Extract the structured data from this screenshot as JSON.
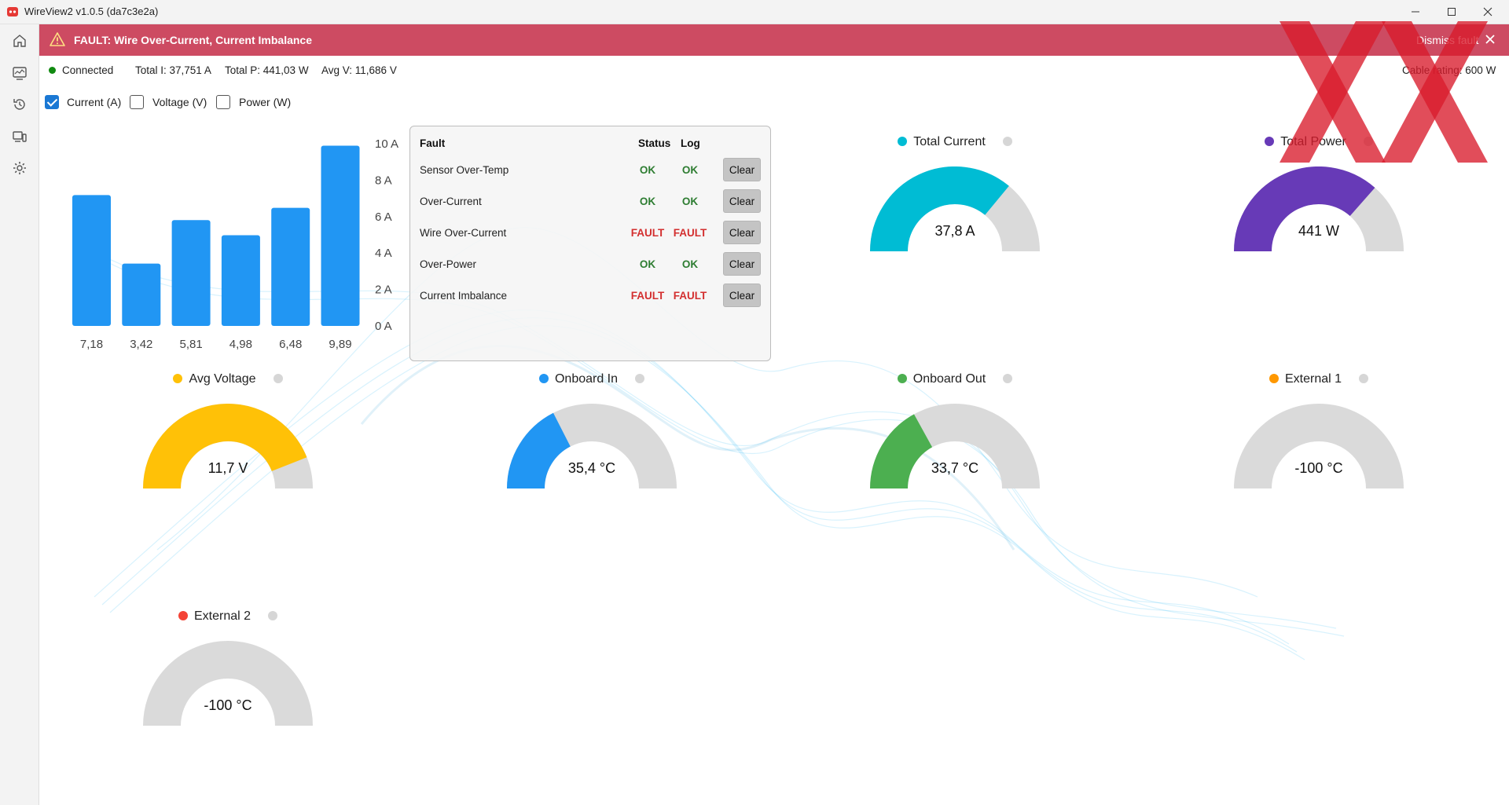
{
  "window": {
    "title": "WireView2 v1.0.5 (da7c3e2a)"
  },
  "fault_banner": {
    "message": "FAULT: Wire Over-Current, Current Imbalance",
    "dismiss_label": "Dismiss fault"
  },
  "status": {
    "connection": "Connected",
    "total_i": "Total I: 37,751 A",
    "total_p": "Total P: 441,03 W",
    "avg_v": "Avg V: 11,686 V",
    "cable_rating": "Cable rating: 600 W"
  },
  "toggles": [
    {
      "label": "Current (A)",
      "checked": true
    },
    {
      "label": "Voltage (V)",
      "checked": false
    },
    {
      "label": "Power (W)",
      "checked": false
    }
  ],
  "chart_data": {
    "type": "bar",
    "categories": [
      "7,18",
      "3,42",
      "5,81",
      "4,98",
      "6,48",
      "9,89"
    ],
    "values": [
      7.18,
      3.42,
      5.81,
      4.98,
      6.48,
      9.89
    ],
    "ylim": [
      0,
      10
    ],
    "y_ticks": [
      "0 A",
      "2 A",
      "4 A",
      "6 A",
      "8 A",
      "10 A"
    ],
    "bar_color": "#2196f3",
    "grid": false
  },
  "fault_table": {
    "headers": {
      "fault": "Fault",
      "status": "Status",
      "log": "Log"
    },
    "clear_label": "Clear",
    "rows": [
      {
        "name": "Sensor Over-Temp",
        "status": "OK",
        "log": "OK"
      },
      {
        "name": "Over-Current",
        "status": "OK",
        "log": "OK"
      },
      {
        "name": "Wire Over-Current",
        "status": "FAULT",
        "log": "FAULT"
      },
      {
        "name": "Over-Power",
        "status": "OK",
        "log": "OK"
      },
      {
        "name": "Current Imbalance",
        "status": "FAULT",
        "log": "FAULT"
      }
    ]
  },
  "gauges": [
    {
      "id": "total-current",
      "title": "Total Current",
      "value": "37,8 A",
      "fraction": 0.72,
      "color": "#00bcd4"
    },
    {
      "id": "total-power",
      "title": "Total Power",
      "value": "441 W",
      "fraction": 0.73,
      "color": "#673ab7"
    },
    {
      "id": "avg-voltage",
      "title": "Avg Voltage",
      "value": "11,7 V",
      "fraction": 0.88,
      "color": "#ffc107"
    },
    {
      "id": "onboard-in",
      "title": "Onboard In",
      "value": "35,4 °C",
      "fraction": 0.35,
      "color": "#2196f3"
    },
    {
      "id": "onboard-out",
      "title": "Onboard Out",
      "value": "33,7 °C",
      "fraction": 0.34,
      "color": "#4caf50"
    },
    {
      "id": "external-1",
      "title": "External 1",
      "value": "-100 °C",
      "fraction": 0,
      "color": "#ff9800"
    },
    {
      "id": "external-2",
      "title": "External 2",
      "value": "-100 °C",
      "fraction": 0,
      "color": "#f44336"
    }
  ],
  "icons": {
    "sidebar": [
      "home-icon",
      "monitor-icon",
      "history-icon",
      "devices-icon",
      "settings-icon"
    ]
  }
}
